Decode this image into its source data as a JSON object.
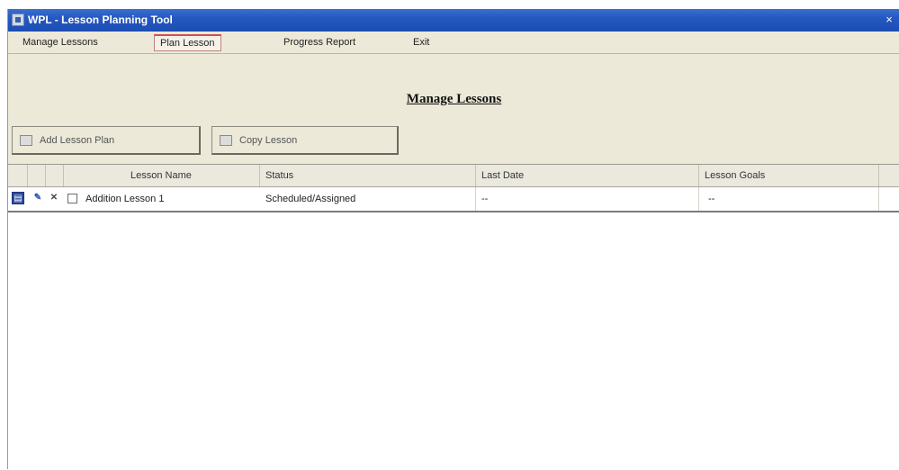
{
  "window": {
    "title": "WPL - Lesson Planning Tool",
    "close_glyph": "×"
  },
  "menu": {
    "items": [
      "Manage Lessons",
      "Plan Lesson",
      "Progress Report",
      "Exit"
    ]
  },
  "page": {
    "heading": "Manage Lessons"
  },
  "toolbar": {
    "add_label": "Add Lesson Plan",
    "copy_label": "Copy Lesson"
  },
  "grid": {
    "columns": [
      "",
      "",
      "",
      "Lesson Name",
      "Status",
      "Last Date",
      "Lesson Goals"
    ],
    "rows": [
      {
        "view_icon": "▤",
        "edit_icon": "✎",
        "delete_icon": "✕",
        "lesson_name": "Addition Lesson 1",
        "status": "Scheduled/Assigned",
        "last_date": "--",
        "lesson_goals": "--"
      }
    ]
  },
  "icons": {
    "app": "app-window-icon",
    "view": "view-record-icon",
    "edit": "edit-record-icon",
    "delete": "delete-record-icon"
  },
  "colors": {
    "titlebar": "#2458c0",
    "window_bg": "#ece9d8",
    "active_tab_border": "#d05050"
  }
}
